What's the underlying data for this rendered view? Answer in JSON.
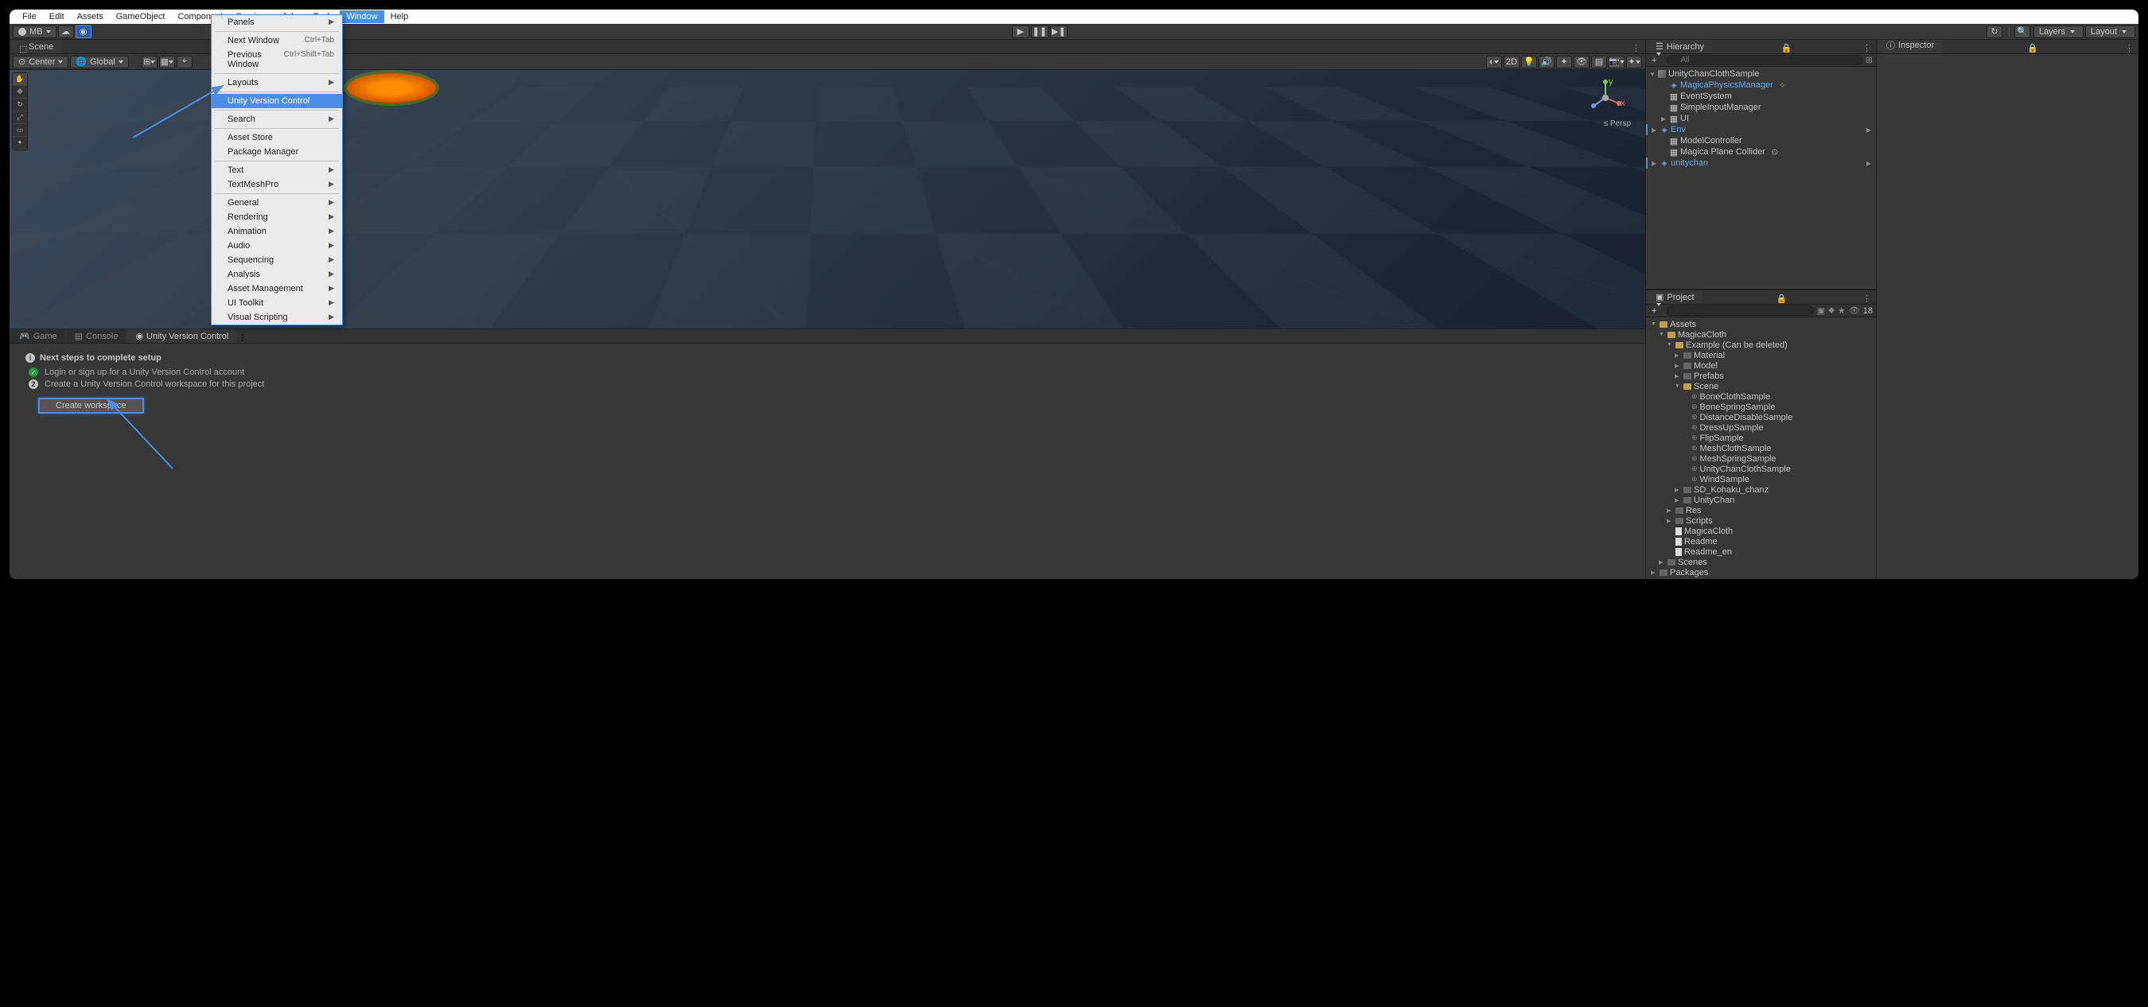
{
  "menubar": [
    "File",
    "Edit",
    "Assets",
    "GameObject",
    "Component",
    "Services",
    "Jobs",
    "Tools",
    "Window",
    "Help"
  ],
  "menubar_selected": "Window",
  "account_label": "MB",
  "play_controls": [
    "play",
    "pause",
    "step"
  ],
  "top_right": {
    "layers": "Layers",
    "layout": "Layout"
  },
  "scene_tab": "Scene",
  "scene_toolbar": {
    "pivot": "Center",
    "space": "Global",
    "twod": "2D"
  },
  "persp_label": "≤ Persp",
  "window_menu": [
    {
      "type": "item",
      "label": "Panels",
      "sub": true
    },
    {
      "type": "sep"
    },
    {
      "type": "item",
      "label": "Next Window",
      "shortcut": "Ctrl+Tab"
    },
    {
      "type": "item",
      "label": "Previous Window",
      "shortcut": "Ctrl+Shift+Tab"
    },
    {
      "type": "sep"
    },
    {
      "type": "item",
      "label": "Layouts",
      "sub": true
    },
    {
      "type": "sep"
    },
    {
      "type": "item",
      "label": "Unity Version Control",
      "highlighted": true
    },
    {
      "type": "sep"
    },
    {
      "type": "item",
      "label": "Search",
      "sub": true
    },
    {
      "type": "sep"
    },
    {
      "type": "item",
      "label": "Asset Store"
    },
    {
      "type": "item",
      "label": "Package Manager"
    },
    {
      "type": "sep"
    },
    {
      "type": "item",
      "label": "Text",
      "sub": true
    },
    {
      "type": "item",
      "label": "TextMeshPro",
      "sub": true
    },
    {
      "type": "sep"
    },
    {
      "type": "item",
      "label": "General",
      "sub": true
    },
    {
      "type": "item",
      "label": "Rendering",
      "sub": true
    },
    {
      "type": "item",
      "label": "Animation",
      "sub": true
    },
    {
      "type": "item",
      "label": "Audio",
      "sub": true
    },
    {
      "type": "item",
      "label": "Sequencing",
      "sub": true
    },
    {
      "type": "item",
      "label": "Analysis",
      "sub": true
    },
    {
      "type": "item",
      "label": "Asset Management",
      "sub": true
    },
    {
      "type": "item",
      "label": "UI Toolkit",
      "sub": true
    },
    {
      "type": "item",
      "label": "Visual Scripting",
      "sub": true
    }
  ],
  "bottom_tabs": {
    "game": "Game",
    "console": "Console",
    "uvc": "Unity Version Control"
  },
  "uvc": {
    "title": "Next steps to complete setup",
    "step1": "Login or sign up for a Unity Version Control account",
    "step2_num": "2",
    "step2": "Create a Unity Version Control workspace for this project",
    "button": "Create workspace"
  },
  "hierarchy_tab": "Hierarchy",
  "hierarchy_search_placeholder": "All",
  "hierarchy": {
    "root": "UnityChanClothSample",
    "items": [
      {
        "name": "MagicaPhysicsManager",
        "prefab": true,
        "star": true
      },
      {
        "name": "EventSystem"
      },
      {
        "name": "SimpleInputManager"
      },
      {
        "name": "UI",
        "expand": true
      },
      {
        "name": "Env",
        "prefab": true,
        "expand": true,
        "rowend": true,
        "bar": true
      },
      {
        "name": "ModelController"
      },
      {
        "name": "Magica Plane Collider",
        "gear": true
      },
      {
        "name": "unitychan",
        "prefab": true,
        "expand": true,
        "rowend": true,
        "bar": true
      }
    ]
  },
  "inspector_tab": "Inspector",
  "project_tab": "Project",
  "project_count": "18",
  "project_tree": [
    {
      "depth": 0,
      "name": "Assets",
      "icon": "folder",
      "expand": "▼"
    },
    {
      "depth": 1,
      "name": "MagicaCloth",
      "icon": "folder",
      "expand": "▼"
    },
    {
      "depth": 2,
      "name": "Example (Can be deleted)",
      "icon": "folder",
      "expand": "▼"
    },
    {
      "depth": 3,
      "name": "Material",
      "icon": "folder-dark",
      "expand": "▶"
    },
    {
      "depth": 3,
      "name": "Model",
      "icon": "folder-dark",
      "expand": "▶"
    },
    {
      "depth": 3,
      "name": "Prefabs",
      "icon": "folder-dark",
      "expand": "▶"
    },
    {
      "depth": 3,
      "name": "Scene",
      "icon": "folder",
      "expand": "▼"
    },
    {
      "depth": 4,
      "name": "BoneClothSample",
      "icon": "scene"
    },
    {
      "depth": 4,
      "name": "BoneSpringSample",
      "icon": "scene"
    },
    {
      "depth": 4,
      "name": "DistanceDisableSample",
      "icon": "scene"
    },
    {
      "depth": 4,
      "name": "DressUpSample",
      "icon": "scene"
    },
    {
      "depth": 4,
      "name": "FlipSample",
      "icon": "scene"
    },
    {
      "depth": 4,
      "name": "MeshClothSample",
      "icon": "scene"
    },
    {
      "depth": 4,
      "name": "MeshSpringSample",
      "icon": "scene"
    },
    {
      "depth": 4,
      "name": "UnityChanClothSample",
      "icon": "scene"
    },
    {
      "depth": 4,
      "name": "WindSample",
      "icon": "scene"
    },
    {
      "depth": 3,
      "name": "SD_Kohaku_chanz",
      "icon": "folder-dark",
      "expand": "▶"
    },
    {
      "depth": 3,
      "name": "UnityChan",
      "icon": "folder-dark",
      "expand": "▶"
    },
    {
      "depth": 2,
      "name": "Res",
      "icon": "folder-dark",
      "expand": "▶"
    },
    {
      "depth": 2,
      "name": "Scripts",
      "icon": "folder-dark",
      "expand": "▶"
    },
    {
      "depth": 2,
      "name": "MagicaCloth",
      "icon": "file"
    },
    {
      "depth": 2,
      "name": "Readme",
      "icon": "file"
    },
    {
      "depth": 2,
      "name": "Readme_en",
      "icon": "file"
    },
    {
      "depth": 1,
      "name": "Scenes",
      "icon": "folder-dark",
      "expand": "▶"
    },
    {
      "depth": 0,
      "name": "Packages",
      "icon": "folder-dark",
      "expand": "▶"
    }
  ]
}
